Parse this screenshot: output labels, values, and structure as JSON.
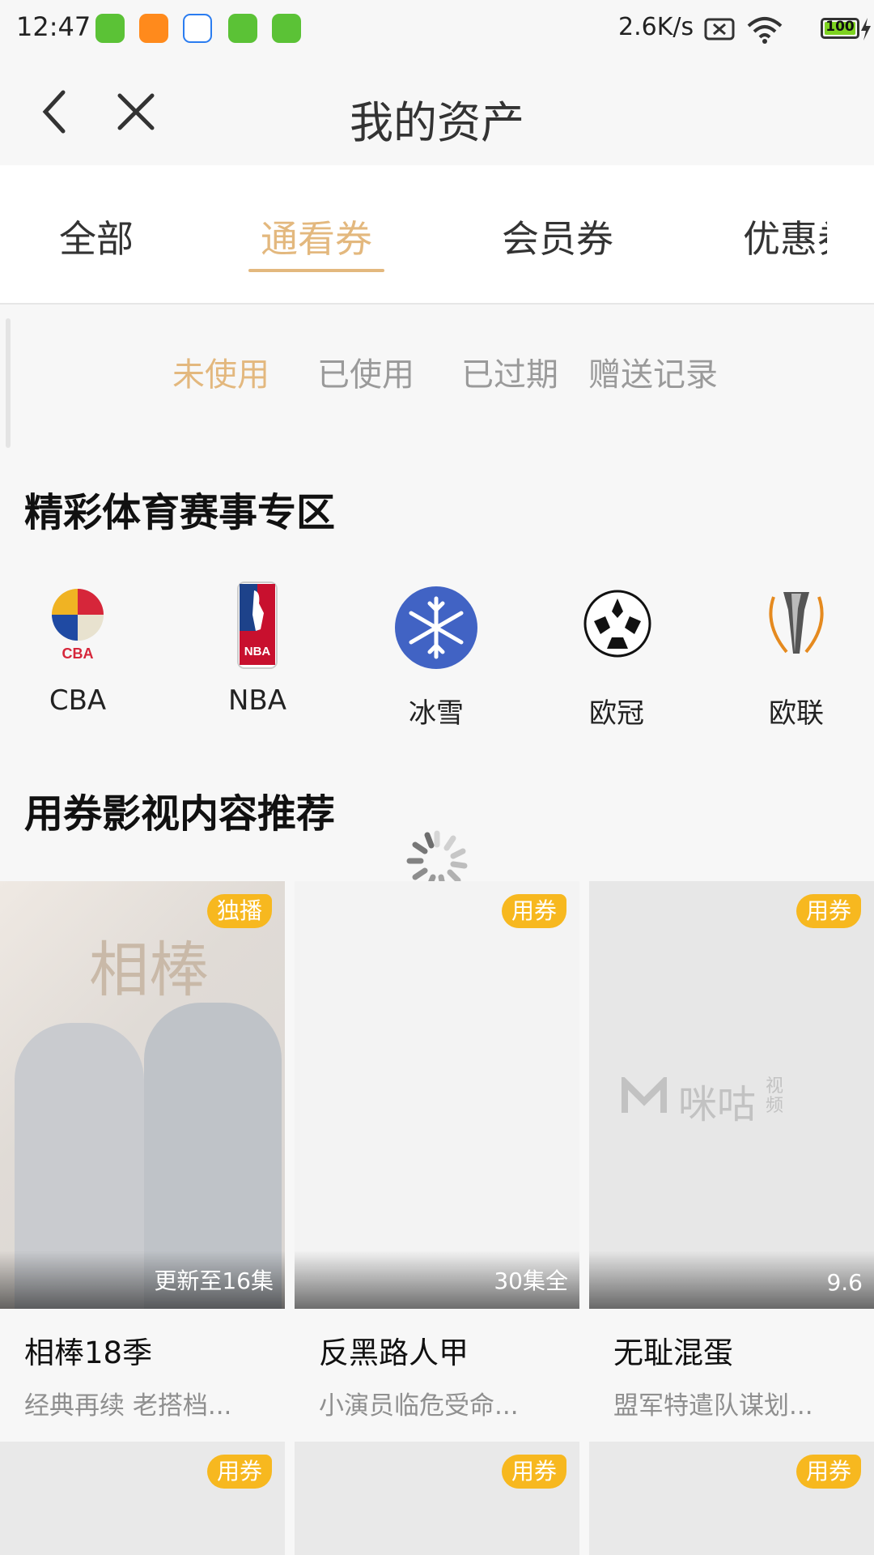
{
  "status_bar": {
    "time": "12:47",
    "net_speed": "2.6K/s",
    "battery": "100",
    "icons": [
      "app-icon",
      "app-icon",
      "app-icon",
      "app-icon",
      "app-icon",
      "no-sim-icon",
      "wifi-icon",
      "battery-icon",
      "charging-icon"
    ]
  },
  "header": {
    "title": "我的资产"
  },
  "tabs": [
    {
      "label": "全部",
      "active": false
    },
    {
      "label": "通看券",
      "active": true
    },
    {
      "label": "会员券",
      "active": false
    },
    {
      "label": "优惠券",
      "active": false
    }
  ],
  "subtabs": [
    {
      "label": "未使用",
      "active": true
    },
    {
      "label": "已使用",
      "active": false
    },
    {
      "label": "已过期",
      "active": false
    },
    {
      "label": "赠送记录",
      "active": false
    }
  ],
  "sports": {
    "title": "精彩体育赛事专区",
    "leagues": [
      {
        "label": "CBA",
        "icon": "cba-logo-icon"
      },
      {
        "label": "NBA",
        "icon": "nba-logo-icon"
      },
      {
        "label": "冰雪",
        "icon": "snowflake-icon"
      },
      {
        "label": "欧冠",
        "icon": "soccer-ball-icon"
      },
      {
        "label": "欧联",
        "icon": "europa-league-icon"
      }
    ]
  },
  "recommend": {
    "title": "用券影视内容推荐",
    "cards": [
      {
        "badge": "独播",
        "poster_text": "相棒",
        "info": "更新至16集",
        "title": "相棒18季",
        "subtitle": "经典再续 老搭档..."
      },
      {
        "badge": "用券",
        "info": "30集全",
        "title": "反黑路人甲",
        "subtitle": "小演员临危受命..."
      },
      {
        "badge": "用券",
        "poster_text": "咪咕",
        "poster_text_small": "视频",
        "info": "9.6",
        "title": "无耻混蛋",
        "subtitle": "盟军特遣队谋划..."
      }
    ],
    "row2_badges": [
      "用券",
      "用券",
      "用券"
    ]
  },
  "colors": {
    "accent": "#e3b87e",
    "badge": "#f7b81f",
    "text": "#222222",
    "muted": "#8f8f8f"
  }
}
